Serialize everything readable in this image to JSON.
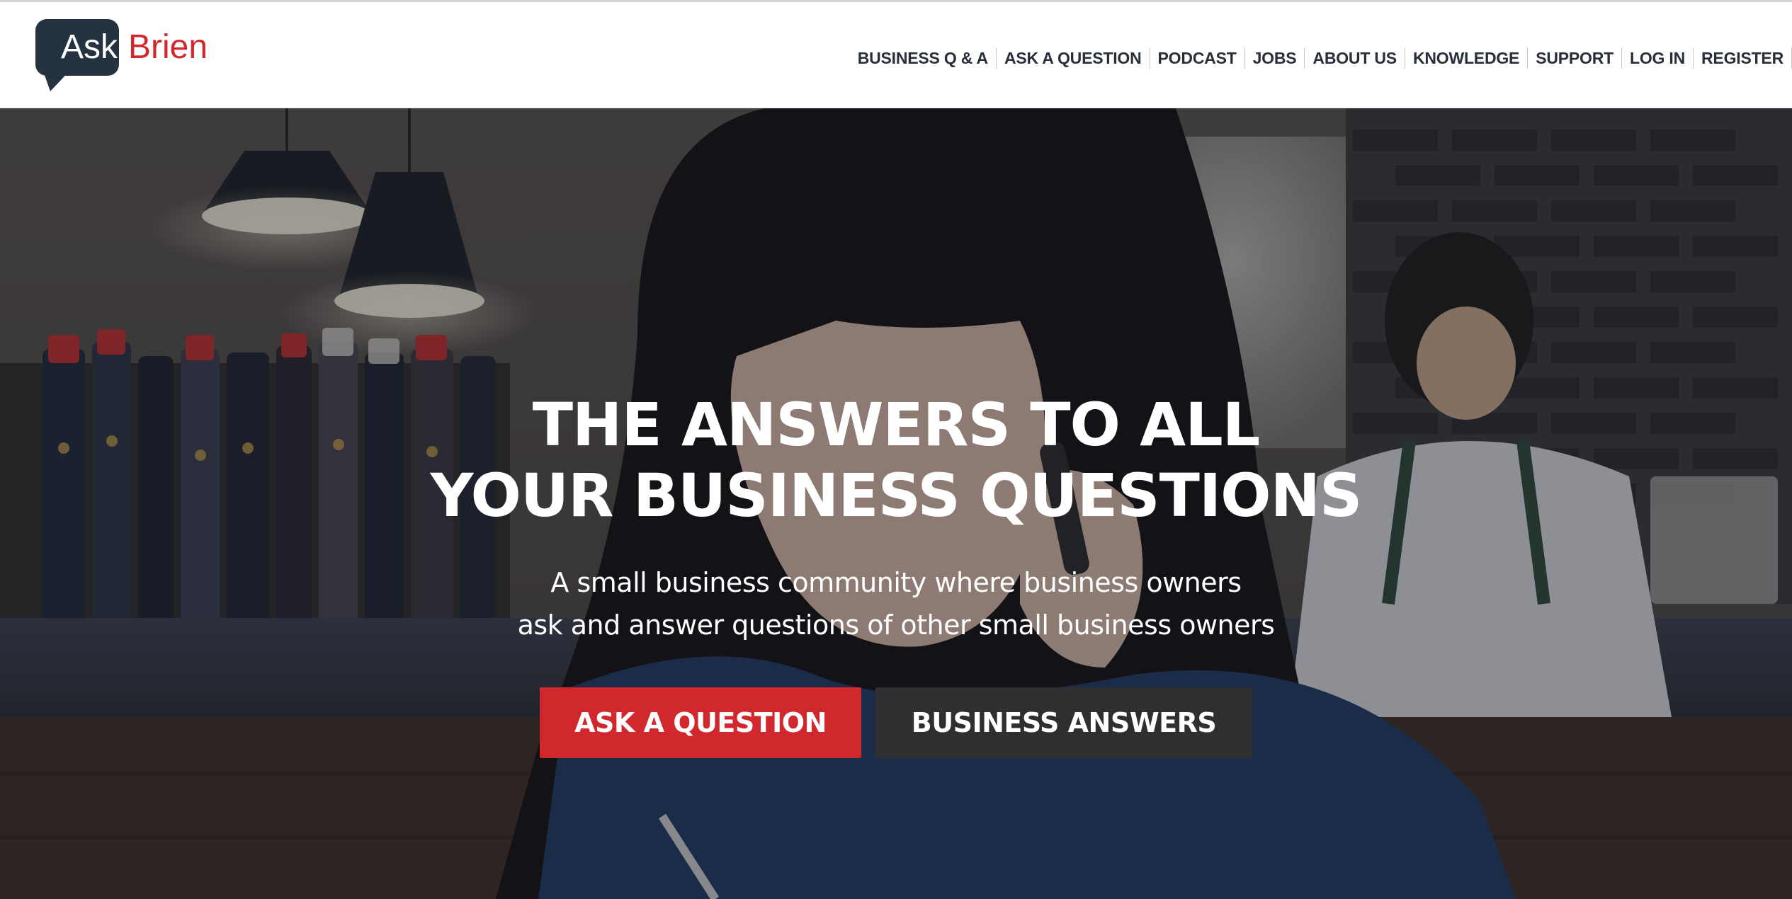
{
  "brand": {
    "logo_part1": "Ask",
    "logo_part2": "Brien",
    "colors": {
      "dark": "#253240",
      "red": "#d0282d"
    }
  },
  "nav": {
    "items": [
      {
        "label": "BUSINESS Q & A"
      },
      {
        "label": "ASK A QUESTION"
      },
      {
        "label": "PODCAST"
      },
      {
        "label": "JOBS"
      },
      {
        "label": "ABOUT US"
      },
      {
        "label": "KNOWLEDGE"
      },
      {
        "label": "SUPPORT"
      },
      {
        "label": "LOG IN"
      },
      {
        "label": "REGISTER"
      }
    ]
  },
  "hero": {
    "headline_line1": "THE ANSWERS TO ALL",
    "headline_line2": "YOUR BUSINESS QUESTIONS",
    "subhead_line1": "A small business community where business owners",
    "subhead_line2": "ask and answer questions of other small business owners",
    "primary_button": "ASK A QUESTION",
    "secondary_button": "BUSINESS ANSWERS"
  }
}
